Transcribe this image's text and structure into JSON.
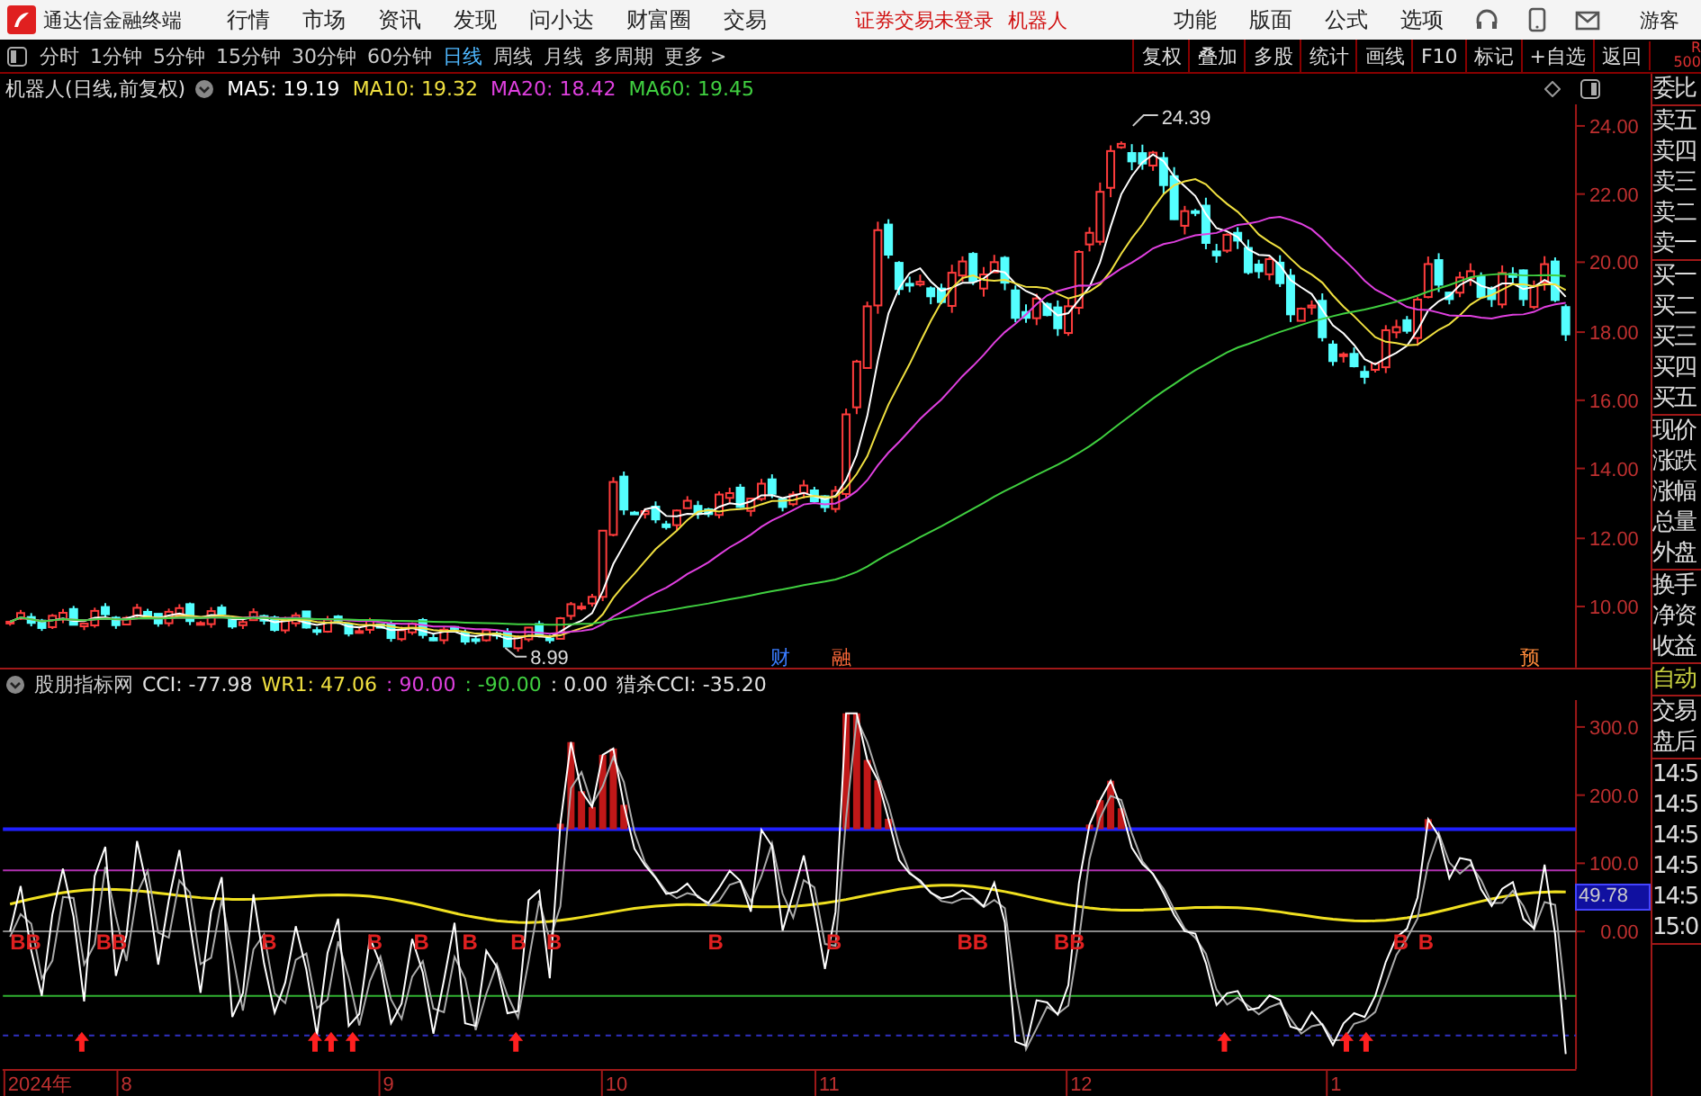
{
  "top_bar": {
    "app_title": "通达信金融终端",
    "menu": [
      "行情",
      "市场",
      "资讯",
      "发现",
      "问小达",
      "财富圈",
      "交易"
    ],
    "login_status": "证券交易未登录",
    "account_name": "机器人",
    "right_menu": [
      "功能",
      "版面",
      "公式",
      "选项"
    ],
    "user": "游客"
  },
  "toolbar": {
    "periods": [
      {
        "label": "分时",
        "selected": false
      },
      {
        "label": "1分钟",
        "selected": false
      },
      {
        "label": "5分钟",
        "selected": false
      },
      {
        "label": "15分钟",
        "selected": false
      },
      {
        "label": "30分钟",
        "selected": false
      },
      {
        "label": "60分钟",
        "selected": false
      },
      {
        "label": "日线",
        "selected": true
      },
      {
        "label": "周线",
        "selected": false
      },
      {
        "label": "月线",
        "selected": false
      },
      {
        "label": "多周期",
        "selected": false
      }
    ],
    "more": "更多 >",
    "tools": [
      "复权",
      "叠加",
      "多股",
      "统计",
      "画线",
      "F10",
      "标记",
      "+自选",
      "返回"
    ],
    "r_label": "R",
    "r_value": "500"
  },
  "price_chart": {
    "title": "机器人(日线,前复权)",
    "ma": [
      {
        "label": "MA5: 19.19",
        "color": "#ffffff"
      },
      {
        "label": "MA10: 19.32",
        "color": "#f0e040"
      },
      {
        "label": "MA20: 18.42",
        "color": "#e040e0"
      },
      {
        "label": "MA60: 19.45",
        "color": "#40d040"
      }
    ],
    "y_ticks": [
      "24.00",
      "22.00",
      "20.00",
      "18.00",
      "16.00",
      "14.00",
      "12.00",
      "10.00"
    ],
    "high_label": "24.39",
    "low_label": "8.99",
    "events": [
      {
        "text": "财",
        "color": "#3a7cff"
      },
      {
        "text": "融",
        "color": "#ff6a3a"
      },
      {
        "text": "预",
        "color": "#ff8a3a"
      }
    ]
  },
  "indicator": {
    "name": "股朋指标网",
    "values": [
      {
        "text": "CCI: -77.98",
        "color": "#e0e0e0"
      },
      {
        "text": "WR1: 47.06",
        "color": "#f0e040"
      },
      {
        "text": ": 90.00",
        "color": "#e040e0"
      },
      {
        "text": ": -90.00",
        "color": "#40d040"
      },
      {
        "text": ": 0.00",
        "color": "#e0e0e0"
      },
      {
        "text": "猎杀CCI: -35.20",
        "color": "#e0e0e0"
      }
    ],
    "y_ticks": [
      "300.0",
      "200.0",
      "100.0",
      "0.00"
    ],
    "current": "49.78",
    "signals": [
      "BB",
      "BB",
      "B",
      "B",
      "B",
      "B",
      "B",
      "B",
      "B",
      "B",
      "BB",
      "BB",
      "B",
      "B"
    ]
  },
  "x_axis": [
    "2024年",
    "8",
    "9",
    "10",
    "11",
    "12",
    "1"
  ],
  "side_panel": {
    "groups": [
      {
        "items": [
          "委比"
        ],
        "highlighted": false
      },
      {
        "items": [
          "卖五",
          "卖四",
          "卖三",
          "卖二",
          "卖一"
        ],
        "highlighted": false
      },
      {
        "items": [
          "买一",
          "买二",
          "买三",
          "买四",
          "买五"
        ],
        "highlighted": false
      },
      {
        "items": [
          "现价",
          "涨跌",
          "涨幅",
          "总量",
          "外盘"
        ],
        "highlighted": false
      },
      {
        "items": [
          "换手",
          "净资",
          "收益"
        ],
        "highlighted": false
      },
      {
        "items": [
          "自动"
        ],
        "highlighted": true
      },
      {
        "items": [
          "交易",
          "盘后"
        ],
        "highlighted": false
      },
      {
        "items": [
          "14:5",
          "14:5",
          "14:5",
          "14:5",
          "14:5",
          "15:0"
        ],
        "highlighted": false
      }
    ]
  }
}
